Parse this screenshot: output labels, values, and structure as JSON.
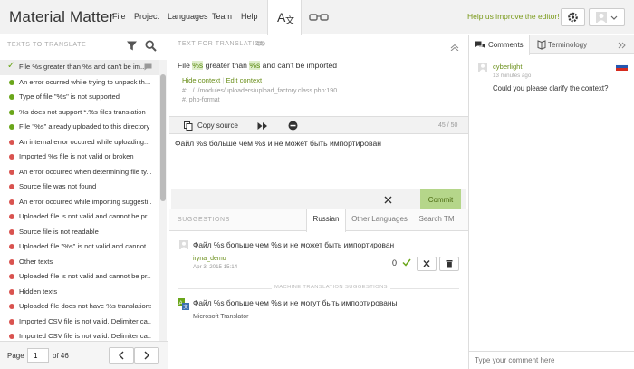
{
  "app": {
    "title": "Material Matter"
  },
  "nav": [
    "File",
    "Project",
    "Languages",
    "Team",
    "Help"
  ],
  "header": {
    "help_link": "Help us improve the editor!"
  },
  "colors": {
    "accent_green": "#6aa61a",
    "error_red": "#d9534f",
    "commit_bg": "#b5d68a"
  },
  "left_panel": {
    "title": "TEXTS TO TRANSLATE",
    "items": [
      {
        "status": "done",
        "label": "File %s greater than %s and can't be im..."
      },
      {
        "status": "translated",
        "label": "An error ocurred while trying to unpack th..."
      },
      {
        "status": "translated",
        "label": "Type of file \"%s\" is not supported"
      },
      {
        "status": "translated",
        "label": "%s does not support *.%s files translation"
      },
      {
        "status": "translated",
        "label": "File \"%s\" already uploaded to this directory"
      },
      {
        "status": "untranslated",
        "label": "An internal error occured while uploading..."
      },
      {
        "status": "untranslated",
        "label": "Imported %s file is not valid or broken"
      },
      {
        "status": "untranslated",
        "label": "An error occurred when determining file ty..."
      },
      {
        "status": "untranslated",
        "label": "Source file was not found"
      },
      {
        "status": "untranslated",
        "label": "An error occurred while importing suggesti..."
      },
      {
        "status": "untranslated",
        "label": "Uploaded file is not valid and cannot be pr..."
      },
      {
        "status": "untranslated",
        "label": "Source file is not readable"
      },
      {
        "status": "untranslated",
        "label": "Uploaded file \"%s\" is not valid and cannot ..."
      },
      {
        "status": "untranslated",
        "label": "Other texts"
      },
      {
        "status": "untranslated",
        "label": "Uploaded file is not valid and cannot be pr..."
      },
      {
        "status": "untranslated",
        "label": "Hidden texts"
      },
      {
        "status": "untranslated",
        "label": "Uploaded file does not have %s translations"
      },
      {
        "status": "untranslated",
        "label": "Imported CSV file is not valid. Delimiter ca..."
      },
      {
        "status": "untranslated",
        "label": "Imported CSV file is not valid. Delimiter ca..."
      }
    ],
    "pager": {
      "label": "Page",
      "current": "1",
      "of_label": "of 46"
    }
  },
  "source": {
    "title": "TEXT FOR TRANSLATION",
    "text_before": "File ",
    "ph1": "%s",
    "text_mid": " greater than ",
    "ph2": "%s",
    "text_after": " and can't be imported",
    "hide_context": "Hide context",
    "edit_context": "Edit context",
    "file_ref": "#: ../../modules/uploaders/upload_factory.class.php:190",
    "format_ref": "#, php-format"
  },
  "toolbar": {
    "copy_source": "Copy source",
    "counter": "45 / 50"
  },
  "editor": {
    "value": "Файл %s больше чем %s и не может быть импортирован"
  },
  "actions": {
    "commit": "Commit"
  },
  "suggestions": {
    "title": "SUGGESTIONS",
    "tabs": [
      "Russian",
      "Other Languages",
      "Search TM"
    ],
    "items": [
      {
        "text": "Файл %s больше чем %s и не может быть импортирован",
        "user": "iryna_demo",
        "date": "Apr 3, 2015 15:14",
        "votes": "0"
      }
    ],
    "machine_label": "MACHINE TRANSLATION SUGGESTIONS",
    "machine": {
      "text": "Файл %s больше чем %s и не могут быть импортированы",
      "provider": "Microsoft Translator"
    }
  },
  "right_panel": {
    "tabs": [
      "Comments",
      "Terminology"
    ],
    "comment": {
      "author": "cyberlight",
      "time": "13 minutes ago",
      "text": "Could you please clarify the context?"
    },
    "input_placeholder": "Type your comment here"
  }
}
